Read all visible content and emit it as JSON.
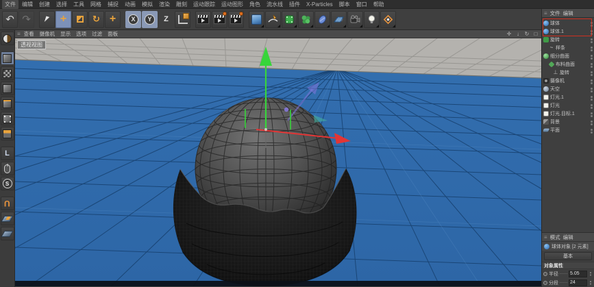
{
  "menubar": {
    "items": [
      "文件",
      "编辑",
      "创建",
      "选择",
      "工具",
      "网格",
      "捕捉",
      "动画",
      "模拟",
      "渲染",
      "雕刻",
      "运动跟踪",
      "运动图形",
      "角色",
      "流水线",
      "插件",
      "X-Particles",
      "脚本",
      "窗口",
      "帮助"
    ]
  },
  "toolbar": {
    "axis_x": "X",
    "axis_y": "Y",
    "axis_z": "Z"
  },
  "viewport": {
    "menu": [
      "查看",
      "摄像机",
      "显示",
      "选项",
      "过滤",
      "面板"
    ],
    "label": "透视视图",
    "corner_icons": [
      "✛",
      "↓",
      "↻",
      "□"
    ]
  },
  "object_manager": {
    "header": [
      "文件",
      "编辑"
    ],
    "items": [
      {
        "label": "球体"
      },
      {
        "label": "球体.1"
      },
      {
        "label": "旋转"
      },
      {
        "label": "样条"
      },
      {
        "label": "细分曲面"
      },
      {
        "label": "布料曲面"
      },
      {
        "label": "旋转"
      },
      {
        "label": "摄像机"
      },
      {
        "label": "天空"
      },
      {
        "label": "灯光.1"
      },
      {
        "label": "灯光"
      },
      {
        "label": "灯光.目标.1"
      },
      {
        "label": "背景"
      },
      {
        "label": "平面"
      }
    ]
  },
  "attributes": {
    "header": [
      "模式",
      "编辑"
    ],
    "title": "球体对象 [2 元素]",
    "tab": "基本",
    "section": "对象属性",
    "rows": [
      {
        "label": "半径",
        "value": "5.05"
      },
      {
        "label": "分段",
        "value": "24"
      }
    ]
  },
  "colors": {
    "accent_orange": "#e8a33d",
    "selection_red": "#d03020",
    "floor_blue": "#3273b5",
    "far_plane_gray": "#b4b2ae",
    "axis_green": "#37d53a",
    "axis_red": "#e23535"
  }
}
